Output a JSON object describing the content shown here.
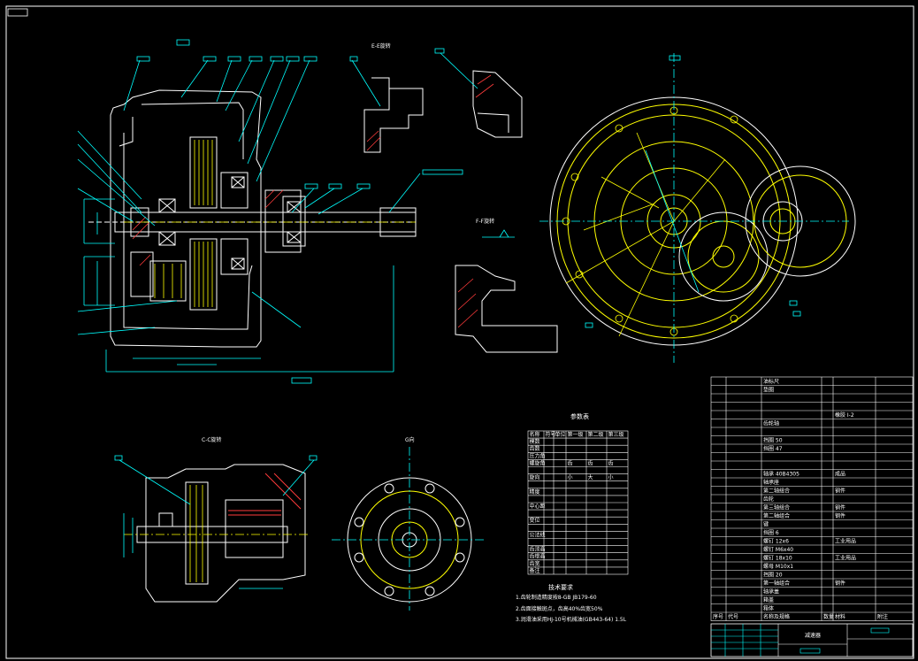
{
  "drawing": {
    "section_labels": {
      "e_view": "E-E旋转",
      "f_view": "F-F旋转",
      "c_view": "C-C旋转",
      "g_view": "G向"
    },
    "param_table": {
      "title": "参数表",
      "headers": [
        "名称",
        "符号",
        "单位",
        "第一级",
        "第二级",
        "第三级"
      ],
      "rows": [
        [
          "模数",
          "",
          "",
          "",
          "",
          ""
        ],
        [
          "齿数",
          "",
          "",
          "",
          "",
          ""
        ],
        [
          "压力角",
          "",
          "",
          "",
          "",
          ""
        ],
        [
          "螺旋角",
          "",
          "",
          "齿",
          "齿",
          "齿"
        ],
        [
          "",
          "",
          "",
          "",
          "",
          ""
        ],
        [
          "旋向",
          "",
          "",
          "小",
          "大",
          "小"
        ],
        [
          "",
          "",
          "",
          "",
          "",
          ""
        ],
        [
          "精度",
          "",
          "",
          "",
          "",
          ""
        ],
        [
          "",
          "",
          "",
          "",
          "",
          ""
        ],
        [
          "中心距",
          "",
          "",
          "",
          "",
          ""
        ],
        [
          "",
          "",
          "",
          "",
          "",
          ""
        ],
        [
          "变位",
          "",
          "",
          "",
          "",
          ""
        ],
        [
          "",
          "",
          "",
          "",
          "",
          ""
        ],
        [
          "公法线",
          "",
          "",
          "",
          "",
          ""
        ],
        [
          "",
          "",
          "",
          "",
          "",
          ""
        ],
        [
          "齿顶高",
          "",
          "",
          "",
          "",
          ""
        ],
        [
          "齿根高",
          "",
          "",
          "",
          "",
          ""
        ],
        [
          "齿宽",
          "",
          "",
          "",
          "",
          ""
        ],
        [
          "备注",
          "",
          "",
          "",
          "",
          ""
        ]
      ]
    },
    "tech_requirements": {
      "title": "技术要求",
      "items": [
        "1.齿轮制造精度按8-GB JB179-60",
        "2.齿面接触斑点，齿高40%齿宽50%",
        "3.润滑油采用HJ-10号机械油(GB443-64) 1.5L"
      ]
    },
    "bom": {
      "rows": [
        [
          "",
          "",
          "油标尺",
          "",
          "",
          ""
        ],
        [
          "",
          "",
          "垫圈",
          "",
          "",
          ""
        ],
        [
          "",
          "",
          "",
          "",
          "",
          ""
        ],
        [
          "",
          "",
          "",
          "",
          "",
          ""
        ],
        [
          "",
          "",
          "",
          "",
          "橡胶 I-2",
          ""
        ],
        [
          "",
          "",
          "齿轮轴",
          "",
          "",
          ""
        ],
        [
          "",
          "",
          "",
          "",
          "",
          ""
        ],
        [
          "",
          "",
          "挡圈 50",
          "",
          "",
          ""
        ],
        [
          "",
          "",
          "挡圈 47",
          "",
          "",
          ""
        ],
        [
          "",
          "",
          "",
          "",
          "",
          ""
        ],
        [
          "",
          "",
          "",
          "",
          "",
          ""
        ],
        [
          "",
          "",
          "轴承 40B4305",
          "",
          "成品",
          ""
        ],
        [
          "",
          "",
          "轴承座",
          "",
          "",
          ""
        ],
        [
          "",
          "",
          "第二轴组合",
          "",
          "钢件",
          ""
        ],
        [
          "",
          "",
          "齿轮",
          "",
          "",
          ""
        ],
        [
          "",
          "",
          "第三轴组合",
          "",
          "钢件",
          ""
        ],
        [
          "",
          "",
          "第二轴组合",
          "",
          "钢件",
          ""
        ],
        [
          "",
          "",
          "键",
          "",
          "",
          ""
        ],
        [
          "",
          "",
          "挡圈 6",
          "",
          "",
          ""
        ],
        [
          "",
          "",
          "螺钉 12x6",
          "",
          "工业用品",
          ""
        ],
        [
          "",
          "",
          "螺钉 M6x40",
          "",
          "",
          ""
        ],
        [
          "",
          "",
          "螺钉 18x10",
          "",
          "工业用品",
          ""
        ],
        [
          "",
          "",
          "螺母 M10x1",
          "",
          "",
          ""
        ],
        [
          "",
          "",
          "挡圈 20",
          "",
          "",
          ""
        ],
        [
          "",
          "",
          "第一轴组合",
          "",
          "钢件",
          ""
        ],
        [
          "",
          "",
          "轴承盖",
          "",
          "",
          ""
        ],
        [
          "",
          "",
          "箱盖",
          "",
          "",
          ""
        ],
        [
          "",
          "",
          "箱体",
          "",
          "",
          ""
        ]
      ],
      "header": [
        "序号",
        "代号",
        "名称及规格",
        "数量",
        "材料",
        "附注"
      ]
    },
    "title_block": {
      "name": "减速器"
    }
  },
  "colors": {
    "background": "#000000",
    "outline": "#ffffff",
    "dimension": "#00ffff",
    "part": "#ffff00",
    "hatch": "#ff3b3b",
    "center": "#ffff00"
  }
}
